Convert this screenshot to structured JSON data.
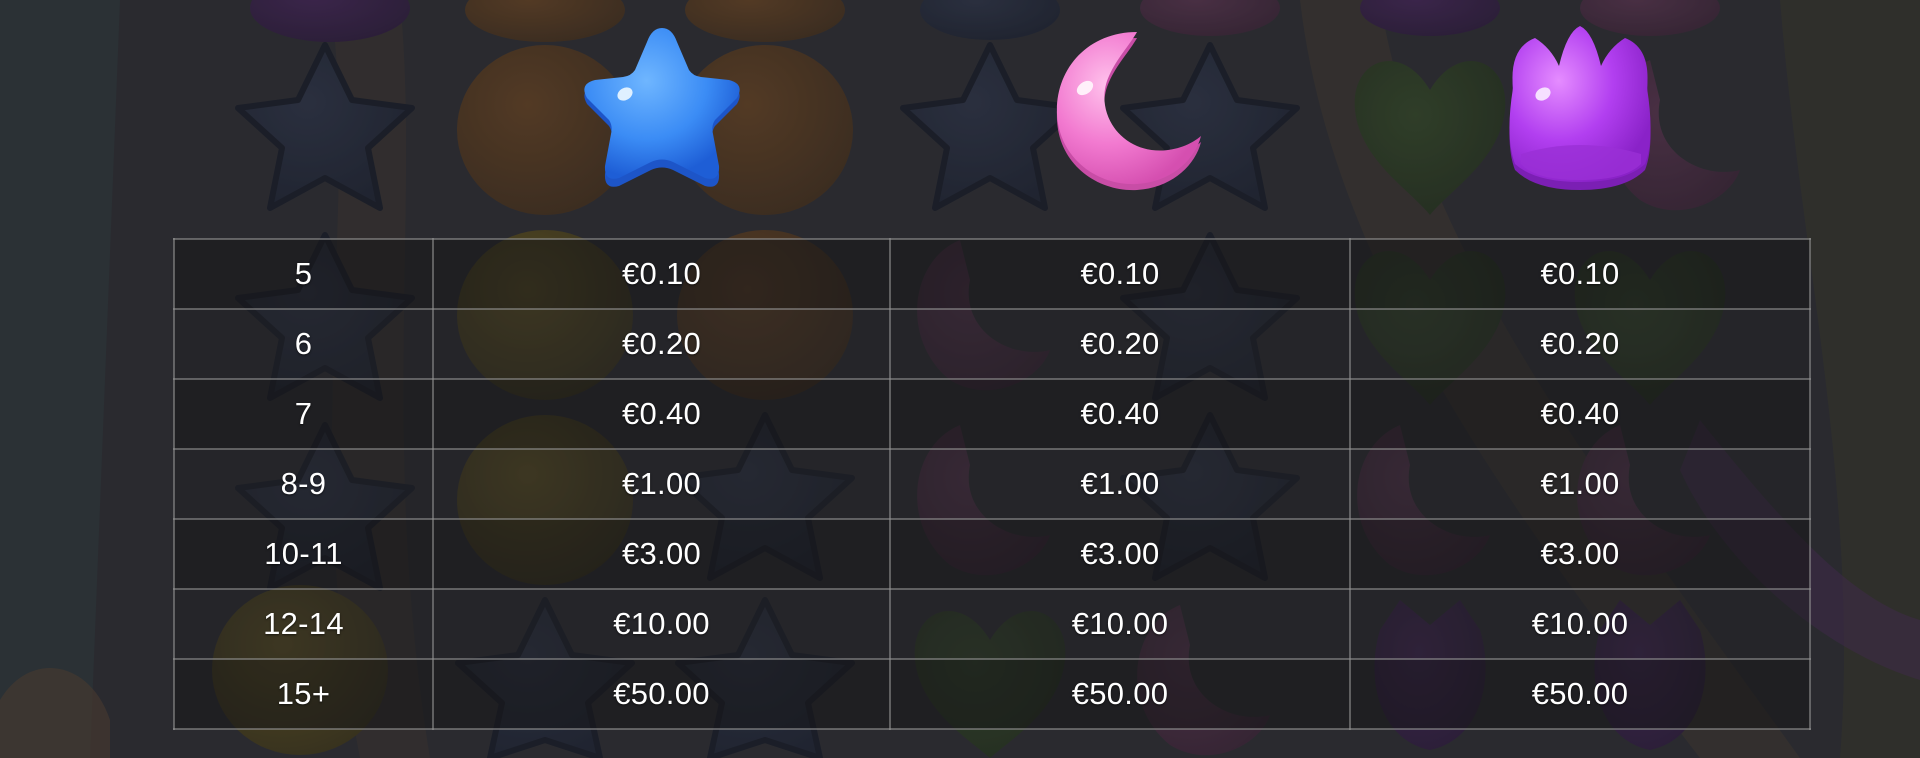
{
  "symbols": [
    {
      "name": "blue-star-candy-icon",
      "color": "#3b8cf5"
    },
    {
      "name": "pink-moon-candy-icon",
      "color": "#f27ad0"
    },
    {
      "name": "purple-tulip-candy-icon",
      "color": "#b23ff0"
    }
  ],
  "paytable": {
    "rows": [
      {
        "count": "5",
        "pays": [
          "€0.10",
          "€0.10",
          "€0.10"
        ]
      },
      {
        "count": "6",
        "pays": [
          "€0.20",
          "€0.20",
          "€0.20"
        ]
      },
      {
        "count": "7",
        "pays": [
          "€0.40",
          "€0.40",
          "€0.40"
        ]
      },
      {
        "count": "8-9",
        "pays": [
          "€1.00",
          "€1.00",
          "€1.00"
        ]
      },
      {
        "count": "10-11",
        "pays": [
          "€3.00",
          "€3.00",
          "€3.00"
        ]
      },
      {
        "count": "12-14",
        "pays": [
          "€10.00",
          "€10.00",
          "€10.00"
        ]
      },
      {
        "count": "15+",
        "pays": [
          "€50.00",
          "€50.00",
          "€50.00"
        ]
      }
    ]
  }
}
